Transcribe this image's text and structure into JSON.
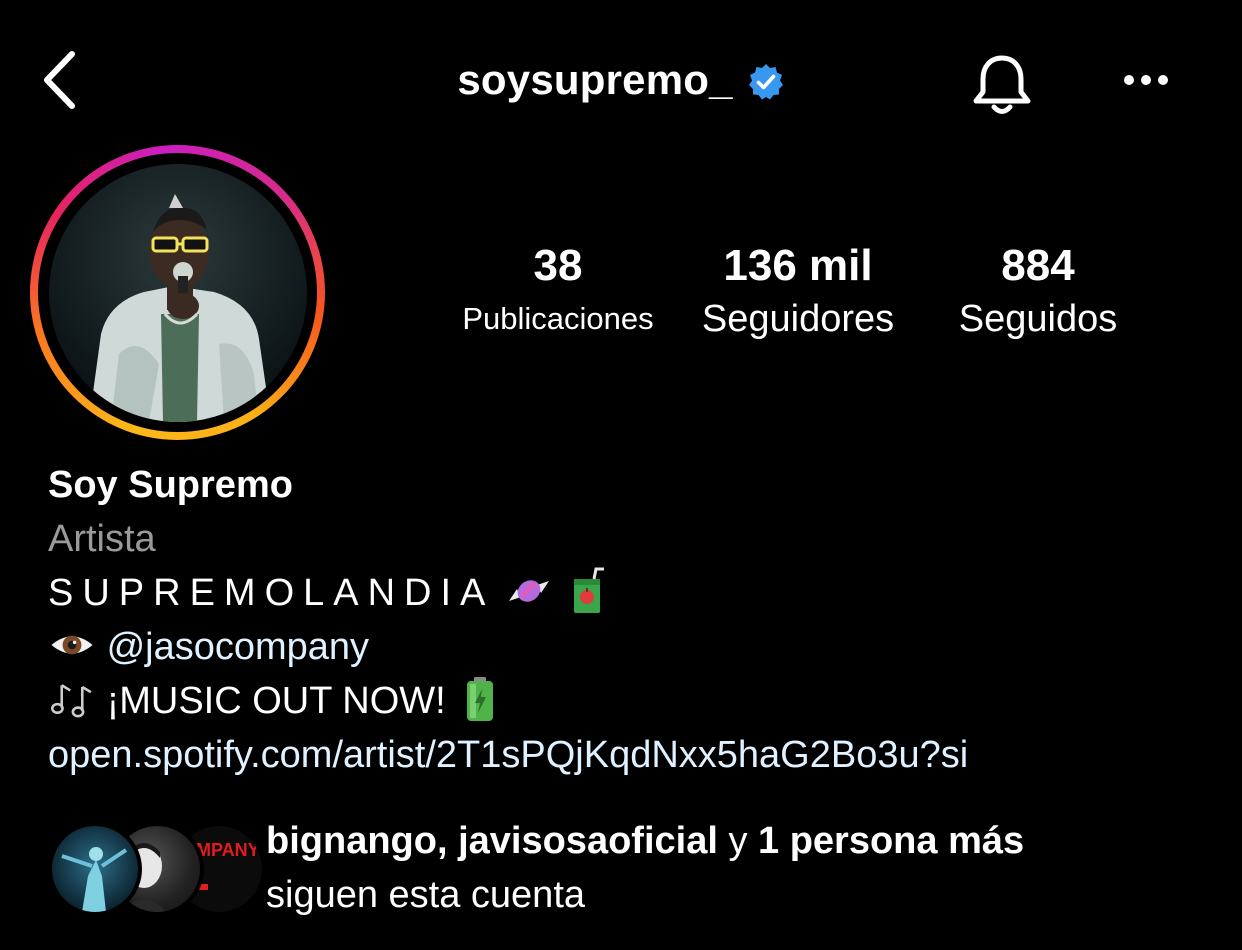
{
  "header": {
    "username": "soysupremo_",
    "verified": true,
    "icons": [
      "chevron-left-icon",
      "verified-badge-icon",
      "bell-icon",
      "more-horizontal-icon"
    ]
  },
  "stats": [
    {
      "value": "38",
      "label": "Publicaciones"
    },
    {
      "value": "136 mil",
      "label": "Seguidores"
    },
    {
      "value": "884",
      "label": "Seguidos"
    }
  ],
  "bio": {
    "name": "Soy Supremo",
    "category": "Artista",
    "tagline": "SUPREMOLANDIA",
    "tagline_emojis": [
      "candy-emoji",
      "juice-box-emoji"
    ],
    "mention_emoji": "eye-emoji",
    "mention": "@jasocompany",
    "music_emoji": "music-notes-emoji",
    "music_text": "¡MUSIC OUT NOW!",
    "music_trailing_emoji": "battery-emoji",
    "link": "open.spotify.com/artist/2T1sPQjKqdNxx5haG2Bo3u?si"
  },
  "followed_by": {
    "names": "bignango, javisosaoficial",
    "connector": "y",
    "more": "1 persona más",
    "suffix": "siguen esta cuenta",
    "avatar3_text": "OMPANY"
  },
  "colors": {
    "background": "#000000",
    "text": "#ffffff",
    "secondary": "#9a9a9a",
    "link": "#e0f1ff",
    "verified": "#3897f0"
  }
}
